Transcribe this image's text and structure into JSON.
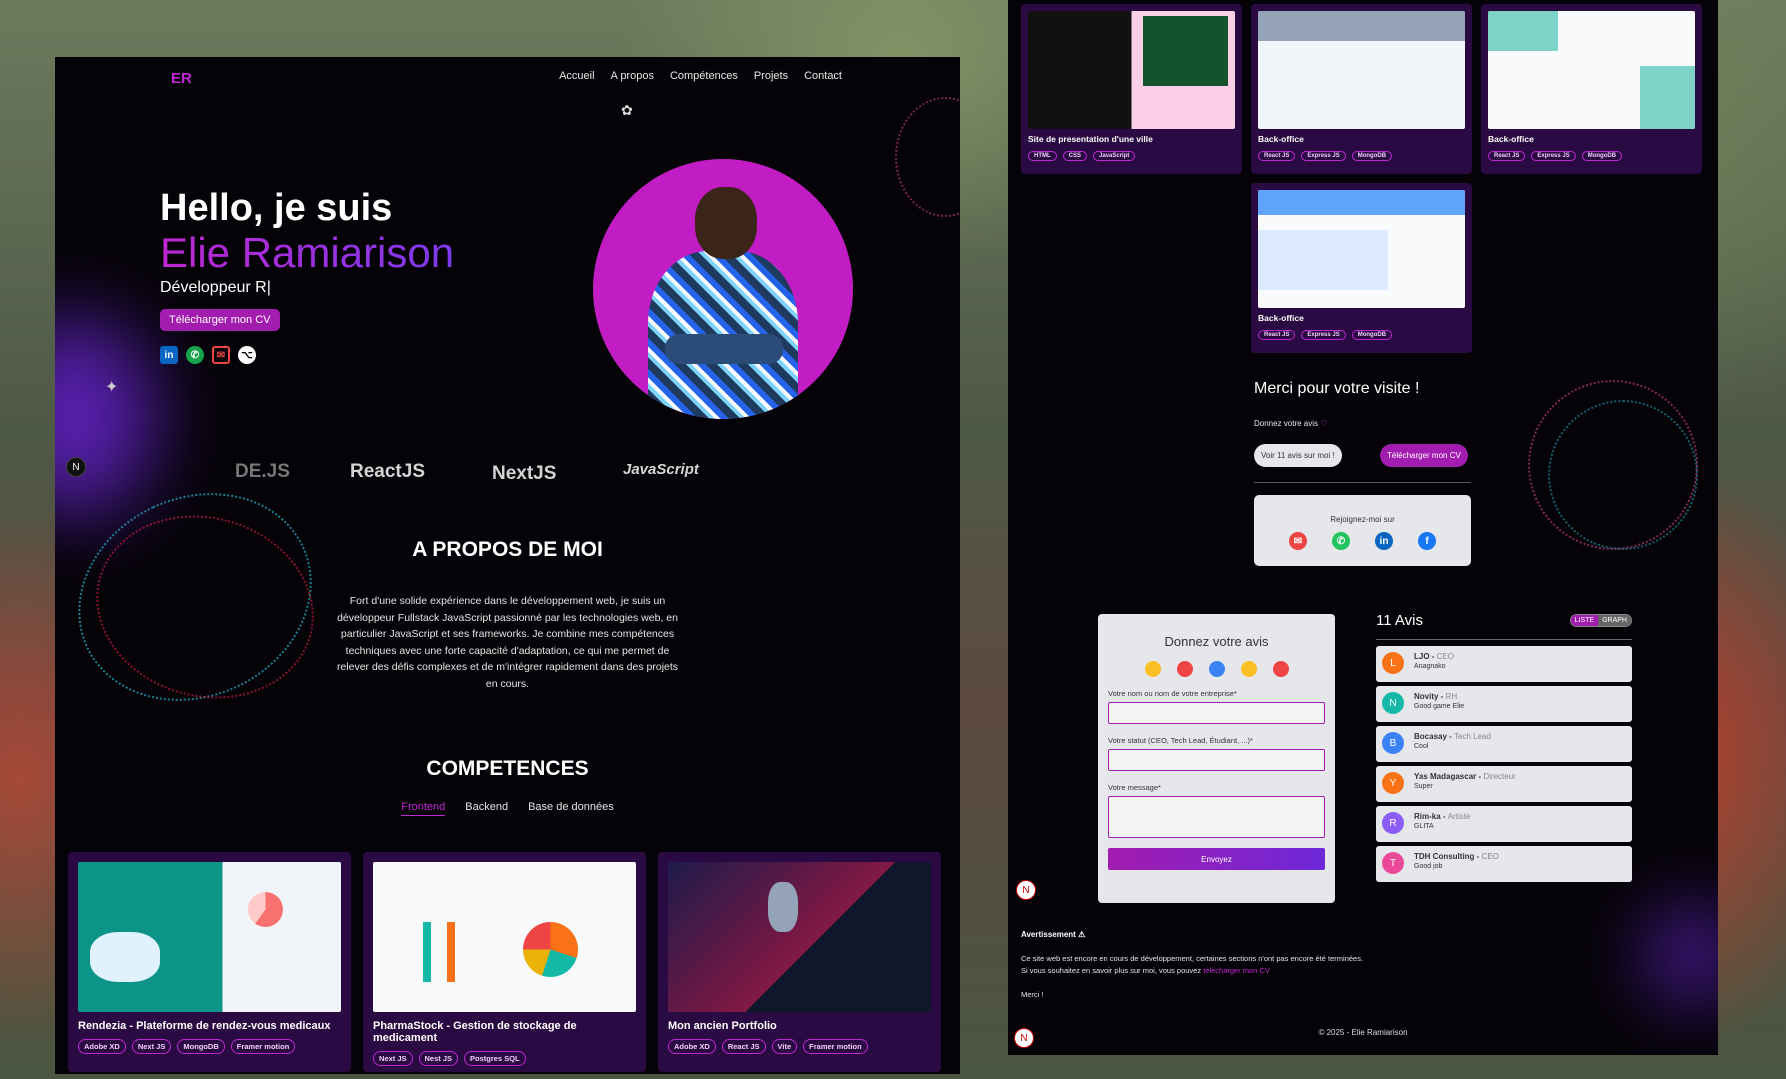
{
  "left": {
    "logo": "ER",
    "nav": [
      "Accueil",
      "A propos",
      "Compétences",
      "Projets",
      "Contact"
    ],
    "hero": {
      "hello": "Hello, je suis",
      "name": "Elie Ramiarison",
      "role": "Développeur R|",
      "cv_button": "Télécharger mon CV"
    },
    "tech": [
      "DE.JS",
      "ReactJS",
      "NextJS",
      "JavaScript"
    ],
    "about": {
      "title": "A PROPOS DE MOI",
      "text": "Fort d'une solide expérience dans le développement web, je suis un développeur Fullstack JavaScript passionné par les technologies web, en particulier JavaScript et ses frameworks. Je combine mes compétences techniques avec une forte capacité d'adaptation, ce qui me permet de relever des défis complexes et de m'intégrer rapidement dans des projets en cours."
    },
    "skills": {
      "title": "COMPETENCES",
      "tabs": [
        "Frontend",
        "Backend",
        "Base de données"
      ]
    },
    "projects": [
      {
        "title": "Rendezia - Plateforme de rendez-vous medicaux",
        "tags": [
          "Adobe XD",
          "Next JS",
          "MongoDB",
          "Framer motion"
        ]
      },
      {
        "title": "PharmaStock - Gestion de stockage de medicament",
        "tags": [
          "Next JS",
          "Nest JS",
          "Postgres SQL"
        ]
      },
      {
        "title": "Mon ancien Portfolio",
        "tags": [
          "Adobe XD",
          "React JS",
          "Vite",
          "Framer motion"
        ]
      }
    ],
    "badge": "N"
  },
  "right": {
    "projects": [
      {
        "title": "Site de presentation d'une ville",
        "tags": [
          "HTML",
          "CSS",
          "JavaScript"
        ]
      },
      {
        "title": "Back-office",
        "tags": [
          "React JS",
          "Express JS",
          "MongoDB"
        ]
      },
      {
        "title": "Back-office",
        "tags": [
          "React JS",
          "Express JS",
          "MongoDB"
        ]
      },
      {
        "title": "Back-office",
        "tags": [
          "React JS",
          "Express JS",
          "MongoDB"
        ]
      }
    ],
    "thanks": "Merci pour votre visite !",
    "give_review": "Donnez votre avis",
    "see_reviews": "Voir 11 avis sur moi !",
    "cv_button": "Télécharger mon CV",
    "join": "Rejoignez-moi sur",
    "form": {
      "title": "Donnez votre avis",
      "name_label": "Votre nom ou nom de votre entreprise*",
      "status_label": "Votre statut (CEO, Tech Lead, Étudiant, ...)*",
      "message_label": "Votre message*",
      "send": "Envoyez"
    },
    "reviews": {
      "title": "11 Avis",
      "toggle": [
        "LISTE",
        "GRAPH"
      ],
      "items": [
        {
          "initial": "L",
          "name": "LJO",
          "role": "CEO",
          "msg": "Anagnako",
          "color": "#f97316"
        },
        {
          "initial": "N",
          "name": "Novity",
          "role": "RH",
          "msg": "Good game Elie",
          "color": "#14b8a6"
        },
        {
          "initial": "B",
          "name": "Bocasay",
          "role": "Tech Lead",
          "msg": "Cool",
          "color": "#3b82f6"
        },
        {
          "initial": "Y",
          "name": "Yas Madagascar",
          "role": "Directeur",
          "msg": "Super",
          "color": "#f97316"
        },
        {
          "initial": "R",
          "name": "Rim-ka",
          "role": "Artiste",
          "msg": "GLITA",
          "color": "#8b5cf6"
        },
        {
          "initial": "T",
          "name": "TDH Consulting",
          "role": "CEO",
          "msg": "Good job",
          "color": "#ec4899"
        }
      ]
    },
    "warning": {
      "title": "Avertissement ⚠",
      "line1": "Ce site web est encore en cours de développement, certaines sections n'ont pas encore été terminées.",
      "line2": "Si vous souhaitez en savoir plus sur moi, vous pouvez",
      "link": "télécharger mon CV",
      "thanks": "Merci !"
    },
    "copyright": "© 2025 - Elie Ramiarison"
  }
}
